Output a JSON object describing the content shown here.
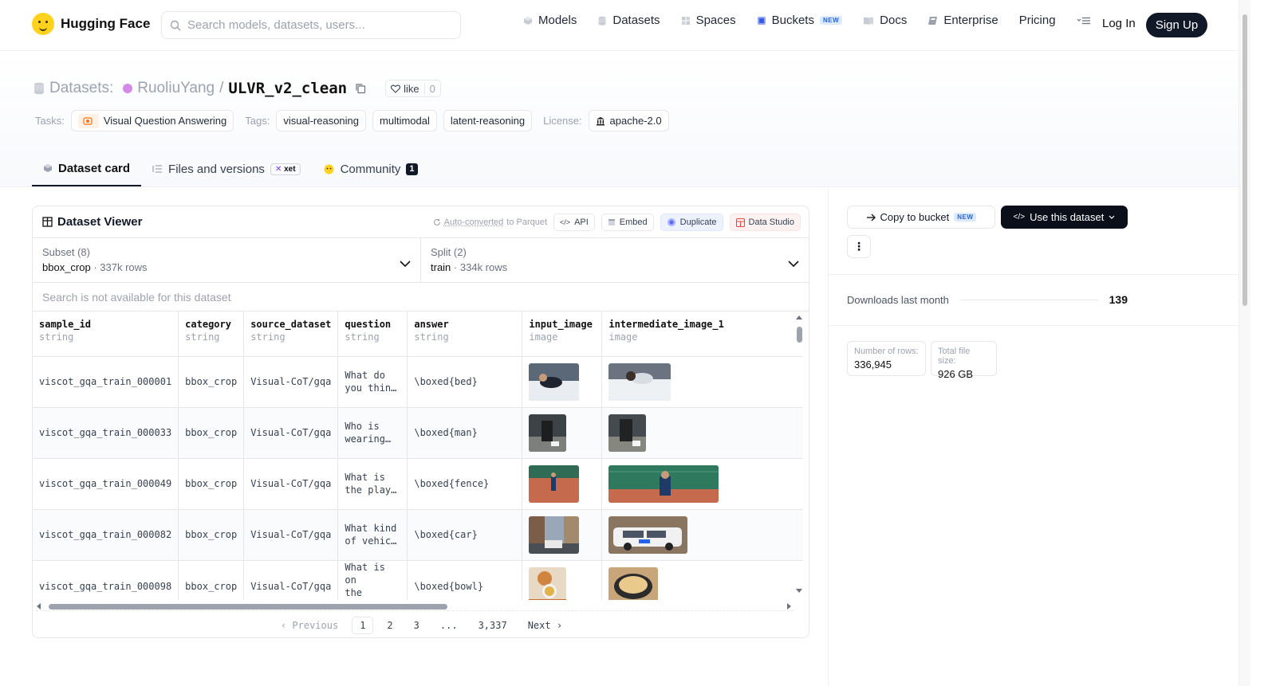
{
  "header": {
    "brand": "Hugging Face",
    "search_placeholder": "Search models, datasets, users...",
    "nav": {
      "models": "Models",
      "datasets": "Datasets",
      "spaces": "Spaces",
      "buckets": "Buckets",
      "buckets_badge": "NEW",
      "docs": "Docs",
      "enterprise": "Enterprise",
      "pricing": "Pricing"
    },
    "login": "Log In",
    "signup": "Sign Up"
  },
  "repo": {
    "type_label": "Datasets:",
    "owner": "RuoliuYang",
    "separator": "/",
    "name": "ULVR_v2_clean",
    "like_label": "like",
    "like_count": "0"
  },
  "tags": {
    "tasks_label": "Tasks:",
    "task": "Visual Question Answering",
    "tags_label": "Tags:",
    "tag_items": [
      "visual-reasoning",
      "multimodal",
      "latent-reasoning"
    ],
    "license_label": "License:",
    "license": "apache-2.0"
  },
  "tabs": {
    "card": "Dataset card",
    "files": "Files and versions",
    "xet": "xet",
    "community": "Community",
    "community_count": "1"
  },
  "viewer": {
    "title": "Dataset Viewer",
    "auto_converted": "Auto-converted",
    "to_parquet": "to Parquet",
    "api": "API",
    "embed": "Embed",
    "duplicate": "Duplicate",
    "data_studio": "Data Studio",
    "subset_label": "Subset (8)",
    "subset_value": "bbox_crop",
    "subset_rows": "337k rows",
    "split_label": "Split (2)",
    "split_value": "train",
    "split_rows": "334k rows",
    "search_note": "Search is not available for this dataset",
    "columns": [
      {
        "name": "sample_id",
        "type": "string"
      },
      {
        "name": "category",
        "type": "string"
      },
      {
        "name": "source_dataset",
        "type": "string"
      },
      {
        "name": "question",
        "type": "string"
      },
      {
        "name": "answer",
        "type": "string"
      },
      {
        "name": "input_image",
        "type": "image"
      },
      {
        "name": "intermediate_image_1",
        "type": "image"
      }
    ],
    "rows": [
      {
        "sample_id": "viscot_gqa_train_000001",
        "category": "bbox_crop",
        "source": "Visual-CoT/gqa",
        "q1": "What do",
        "q2": "you thin…",
        "answer": "\\boxed{bed}"
      },
      {
        "sample_id": "viscot_gqa_train_000033",
        "category": "bbox_crop",
        "source": "Visual-CoT/gqa",
        "q1": "Who is",
        "q2": "wearing…",
        "answer": "\\boxed{man}"
      },
      {
        "sample_id": "viscot_gqa_train_000049",
        "category": "bbox_crop",
        "source": "Visual-CoT/gqa",
        "q1": "What is",
        "q2": "the play…",
        "answer": "\\boxed{fence}"
      },
      {
        "sample_id": "viscot_gqa_train_000082",
        "category": "bbox_crop",
        "source": "Visual-CoT/gqa",
        "q1": "What kind",
        "q2": "of vehic…",
        "answer": "\\boxed{car}"
      },
      {
        "sample_id": "viscot_gqa_train_000098",
        "category": "bbox_crop",
        "source": "Visual-CoT/gqa",
        "q1": "What is on",
        "q2": "the shelf?",
        "answer": "\\boxed{bowl}"
      }
    ],
    "pager": {
      "previous": "Previous",
      "pages": [
        "1",
        "2",
        "3",
        "...",
        "3,337"
      ],
      "next": "Next"
    }
  },
  "sidebar": {
    "copy_to_bucket": "Copy to bucket",
    "copy_badge": "NEW",
    "use_dataset": "Use this dataset",
    "downloads_label": "Downloads last month",
    "downloads_value": "139",
    "rows_label": "Number of rows:",
    "rows_value": "336,945",
    "size_label": "Total file size:",
    "size_value": "926 GB"
  },
  "colors": {
    "brand_yellow": "#FFD21E",
    "dark": "#111827",
    "badge_blue": "#2563eb"
  }
}
